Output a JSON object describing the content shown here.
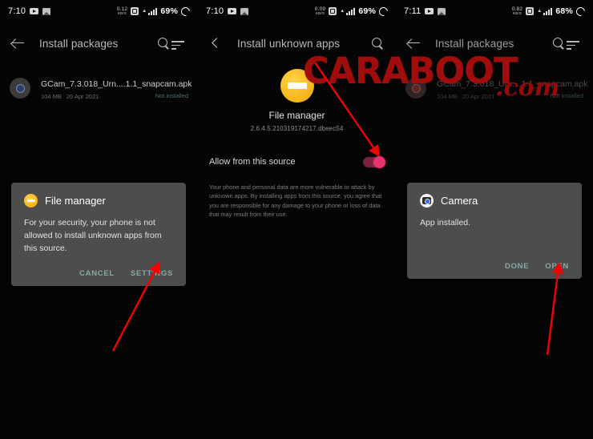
{
  "panels": [
    {
      "id": "install-packages-before",
      "statusbar": {
        "time": "7:10",
        "netspeed_value": "0.12",
        "netspeed_unit": "KB/S",
        "battery_percent": "69%",
        "icons": [
          "youtube-icon",
          "screenshot-icon",
          "wifi-icon",
          "signal-icon",
          "battery-circle-icon"
        ]
      },
      "appbar": {
        "title": "Install packages",
        "back_icon": "back-arrow-icon",
        "search_icon": "search-icon",
        "sort_icon": "sort-icon"
      },
      "file": {
        "name": "GCam_7.3.018_Urn....1.1_snapcam.apk",
        "size": "104 MB",
        "date": "20 Apr 2021",
        "status": "Not installed",
        "icon": "camera-apk-icon"
      }
    },
    {
      "id": "install-unknown-apps",
      "statusbar": {
        "time": "7:10",
        "netspeed_value": "0.09",
        "netspeed_unit": "KB/S",
        "battery_percent": "69%"
      },
      "appbar": {
        "title": "Install unknown apps",
        "back_icon": "chevron-left-icon",
        "search_icon": "search-icon"
      },
      "app": {
        "icon": "file-manager-icon",
        "name": "File manager",
        "version": "2.6.4.5.210319174217.dbeec54"
      },
      "allow_row": {
        "label": "Allow from this source",
        "toggle_state": "on"
      },
      "warning": "Your phone and personal data are more vulnerable to attack by unknown apps. By installing apps from this source, you agree that you are responsible for any damage to your phone or loss of data that may result from their use."
    },
    {
      "id": "install-packages-after",
      "statusbar": {
        "time": "7:11",
        "netspeed_value": "0.82",
        "netspeed_unit": "KB/S",
        "battery_percent": "68%"
      },
      "appbar": {
        "title": "Install packages",
        "back_icon": "back-arrow-icon",
        "search_icon": "search-icon",
        "sort_icon": "sort-icon"
      },
      "file": {
        "name": "GCam_7.3.018_Urn....1.1_snapcam.apk",
        "size": "104 MB",
        "date": "20 Apr 2021",
        "status": "Not installed",
        "icon": "camera-apk-icon"
      }
    }
  ],
  "dialog_left": {
    "icon": "file-manager-icon",
    "title": "File manager",
    "body": "For your security, your phone is not allowed to install unknown apps from this source.",
    "cancel_label": "CANCEL",
    "settings_label": "SETTINGS"
  },
  "dialog_right": {
    "icon": "camera-icon",
    "title": "Camera",
    "body": "App installed.",
    "done_label": "DONE",
    "open_label": "OPEN"
  },
  "watermark": {
    "main": "CARABOOT",
    "suffix": ".com",
    "color": "#a00d0d"
  },
  "colors": {
    "background": "#000000",
    "dialog_bg": "#4d4d4d",
    "accent_button": "#86a9a4",
    "toggle_on": "#e8336d",
    "arrow": "#f60000",
    "app_icon": "#f6b81f"
  }
}
